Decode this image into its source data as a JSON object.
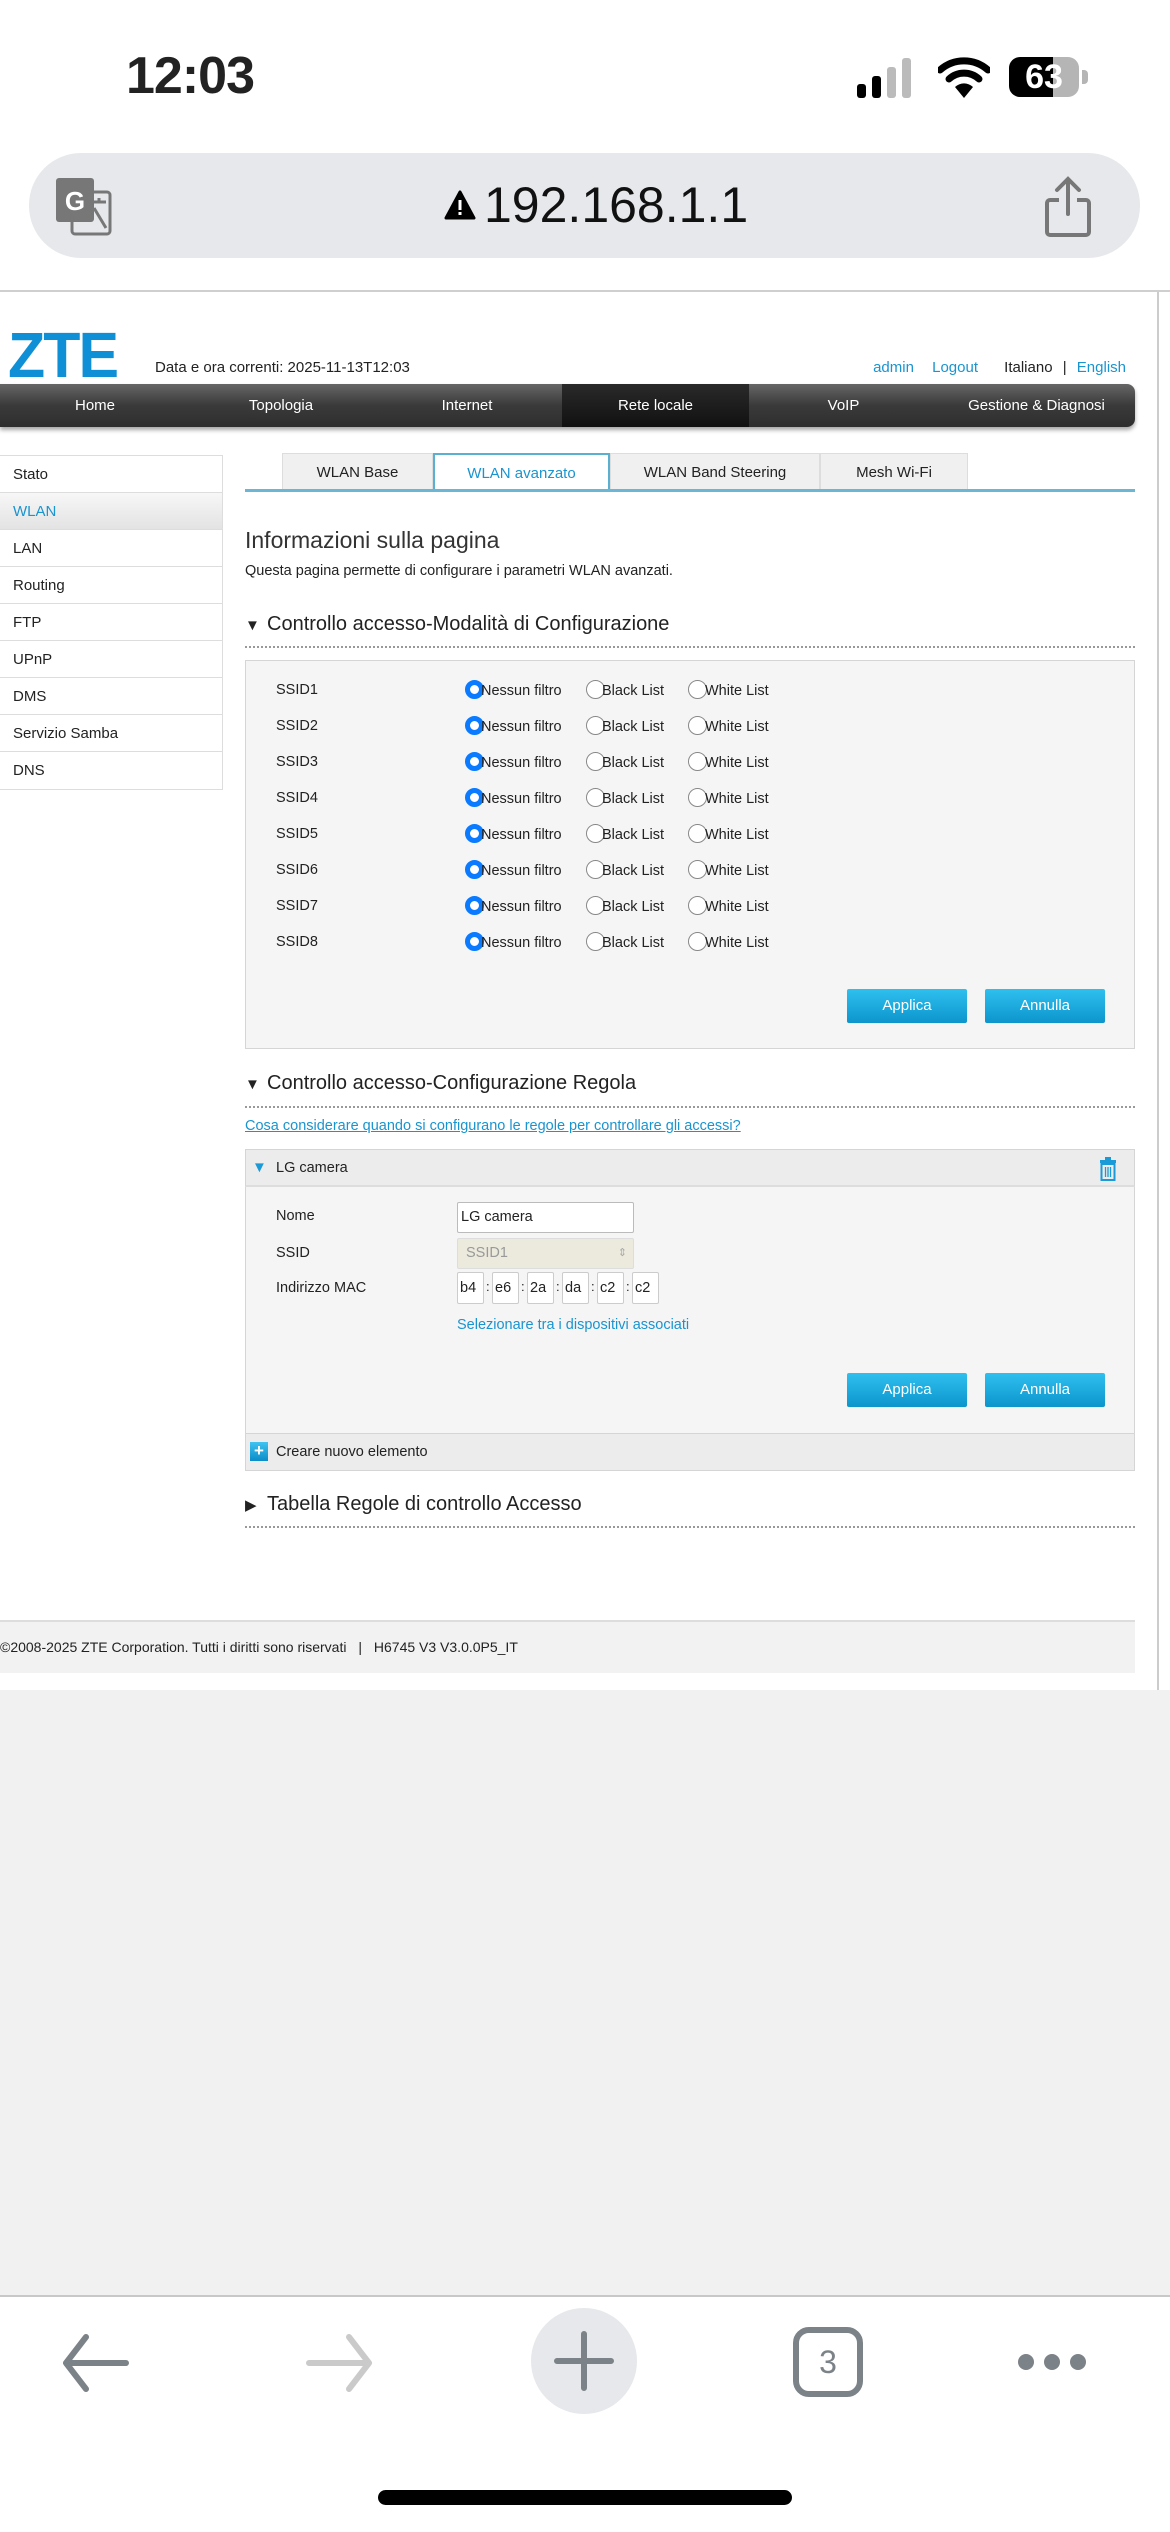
{
  "status_bar": {
    "time": "12:03",
    "battery": "63"
  },
  "browser": {
    "url": "192.168.1.1",
    "tab_count": "3"
  },
  "header": {
    "logo": "ZTE",
    "datetime": "Data e ora correnti: 2025-11-13T12:03",
    "user": "admin",
    "logout": "Logout",
    "lang_it": "Italiano",
    "lang_sep": "|",
    "lang_en": "English"
  },
  "nav": [
    {
      "label": "Home"
    },
    {
      "label": "Topologia"
    },
    {
      "label": "Internet"
    },
    {
      "label": "Rete locale",
      "active": true
    },
    {
      "label": "VoIP"
    },
    {
      "label": "Gestione & Diagnosi"
    }
  ],
  "sidebar": [
    {
      "label": "Stato"
    },
    {
      "label": "WLAN",
      "active": true
    },
    {
      "label": "LAN"
    },
    {
      "label": "Routing"
    },
    {
      "label": "FTP"
    },
    {
      "label": "UPnP"
    },
    {
      "label": "DMS"
    },
    {
      "label": "Servizio Samba"
    },
    {
      "label": "DNS"
    }
  ],
  "tabs": [
    {
      "label": "WLAN Base"
    },
    {
      "label": "WLAN avanzato",
      "active": true
    },
    {
      "label": "WLAN Band Steering"
    },
    {
      "label": "Mesh Wi-Fi"
    }
  ],
  "page": {
    "title": "Informazioni sulla pagina",
    "description": "Questa pagina permette di configurare i parametri WLAN avanzati."
  },
  "mode_section": {
    "title": "Controllo accesso-Modalità di Configurazione",
    "options": [
      "Nessun filtro",
      "Black List",
      "White List"
    ],
    "rows": [
      {
        "ssid": "SSID1",
        "selected": 0
      },
      {
        "ssid": "SSID2",
        "selected": 0
      },
      {
        "ssid": "SSID3",
        "selected": 0
      },
      {
        "ssid": "SSID4",
        "selected": 0
      },
      {
        "ssid": "SSID5",
        "selected": 0
      },
      {
        "ssid": "SSID6",
        "selected": 0
      },
      {
        "ssid": "SSID7",
        "selected": 0
      },
      {
        "ssid": "SSID8",
        "selected": 0
      }
    ],
    "apply": "Applica",
    "cancel": "Annulla"
  },
  "rule_section": {
    "title": "Controllo accesso-Configurazione Regola",
    "help_link": "Cosa considerare quando si configurano le regole per controllare gli accessi?",
    "rule_name": "LG camera",
    "name_label": "Nome",
    "name_value": "LG camera",
    "ssid_label": "SSID",
    "ssid_value": "SSID1",
    "mac_label": "Indirizzo MAC",
    "mac": [
      "b4",
      "e6",
      "2a",
      "da",
      "c2",
      "c2"
    ],
    "mac_sep": ":",
    "select_devices": "Selezionare tra i dispositivi associati",
    "apply": "Applica",
    "cancel": "Annulla",
    "create_new": "Creare nuovo elemento"
  },
  "table_section": {
    "title": "Tabella Regole di controllo Accesso"
  },
  "footer": {
    "copyright": "©2008-2025 ZTE Corporation. Tutti i diritti sono riservati",
    "sep": "|",
    "version": "H6745 V3 V3.0.0P5_IT"
  }
}
